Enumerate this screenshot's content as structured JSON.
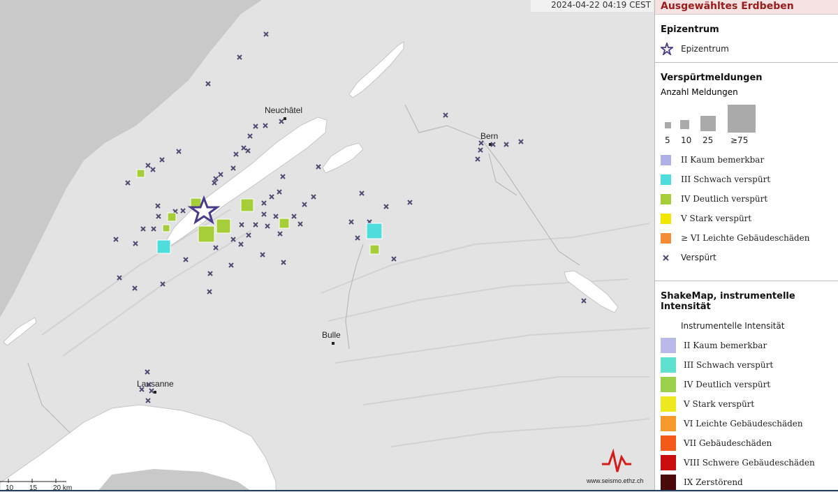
{
  "timestamp": "2024-04-22 04:19 CEST",
  "map": {
    "places": [
      {
        "name": "Neuchâtel"
      },
      {
        "name": "Bern"
      },
      {
        "name": "Bulle"
      },
      {
        "name": "Lausanne"
      }
    ],
    "scale": {
      "labels": [
        "10",
        "15",
        "20 km"
      ]
    },
    "credit": "www.seismo.ethz.ch",
    "colors": {
      "land": "#e3e3e3",
      "lake": "#ffffff",
      "epicenter": "#4b3a8c",
      "marker": "#4f4a72"
    }
  },
  "legend": {
    "title": "Ausgewähltes Erdbeben",
    "epicenter": {
      "title": "Epizentrum",
      "label": "Epizentrum"
    },
    "felt": {
      "title": "Verspürtmeldungen",
      "subtitle": "Anzahl Meldungen",
      "size_labels": [
        "5",
        "10",
        "25",
        "≥75"
      ],
      "items": [
        {
          "label": "II Kaum bemerkbar",
          "color": "#b0b0e8"
        },
        {
          "label": "III Schwach verspürt",
          "color": "#4fdcdc"
        },
        {
          "label": "IV Deutlich verspürt",
          "color": "#a6ce39"
        },
        {
          "label": "V Stark verspürt",
          "color": "#f3e600"
        },
        {
          "label": "≥ VI Leichte Gebäudeschäden",
          "color": "#f58b35"
        },
        {
          "label": "Verspürt",
          "icon": "x-marker"
        }
      ]
    },
    "shakemap": {
      "title": "ShakeMap, instrumentelle Intensität",
      "subtitle": "Instrumentelle Intensität",
      "items": [
        {
          "label": "II Kaum bemerkbar",
          "color": "#b9b9ea"
        },
        {
          "label": "III Schwach verspürt",
          "color": "#5fe0cf"
        },
        {
          "label": "IV Deutlich verspürt",
          "color": "#9bd04a"
        },
        {
          "label": "V Stark verspürt",
          "color": "#ece91f"
        },
        {
          "label": "VI Leichte Gebäudeschäden",
          "color": "#f6992d"
        },
        {
          "label": "VII Gebäudeschäden",
          "color": "#f35a18"
        },
        {
          "label": "VIII Schwere Gebäudeschäden",
          "color": "#c90d0d"
        },
        {
          "label": "IX Zerstörend",
          "color": "#4a0a0a"
        }
      ]
    }
  }
}
